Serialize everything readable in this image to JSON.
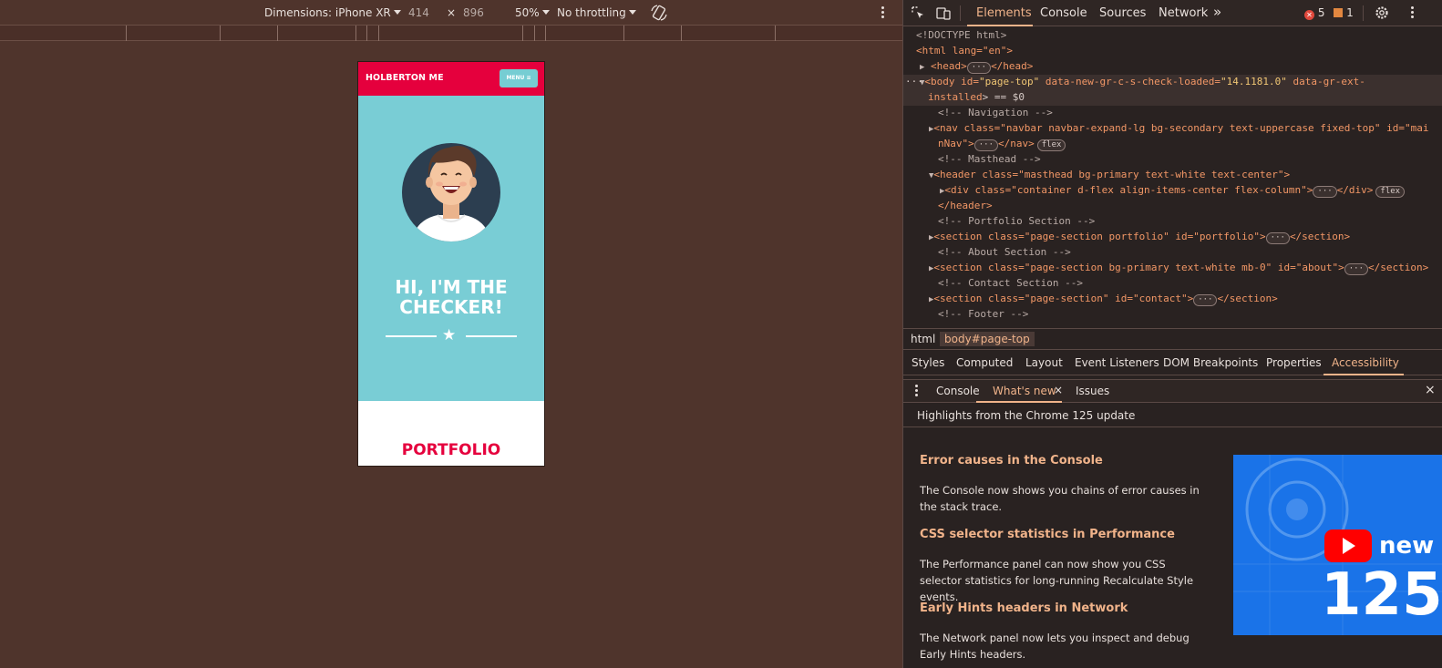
{
  "device_toolbar": {
    "dimensions_label": "Dimensions: iPhone XR",
    "width": "414",
    "times": "×",
    "height": "896",
    "zoom": "50%",
    "throttling": "No throttling"
  },
  "site": {
    "brand": "HOLBERTON ME",
    "menu_label": "MENU ≡",
    "headline": "HI, I'M THE CHECKER!",
    "divider_star": "★",
    "section_title": "PORTFOLIO"
  },
  "devtools": {
    "tabs": [
      "Elements",
      "Console",
      "Sources",
      "Network"
    ],
    "more_tabs": "»",
    "errors": "5",
    "warnings": "1",
    "dom": {
      "doctype": "<!DOCTYPE html>",
      "html_open": "<html lang=\"en\">",
      "head": "<head>",
      "head_close": "</head>",
      "body_tag": "<body",
      "body_id_attr": " id=",
      "body_id_val": "\"page-top\"",
      "body_attr2": " data-new-gr-c-s-check-loaded=",
      "body_val2": "\"14.1181.0\"",
      "body_attr3": " data-gr-ext-",
      "body_attr3b": "installed",
      "body_eq": "> == $0",
      "c_nav": "<!-- Navigation -->",
      "nav_line": "<nav class=\"navbar navbar-expand-lg bg-secondary text-uppercase fixed-top\" id=\"mai",
      "nav_line2": "nNav\">",
      "nav_close": "</nav>",
      "c_masthead": "<!-- Masthead -->",
      "header_line": "<header class=\"masthead bg-primary text-white text-center\">",
      "div_line": "<div class=\"container d-flex align-items-center flex-column\">",
      "div_close": "</div>",
      "header_close": "</header>",
      "c_portfolio": "<!-- Portfolio Section -->",
      "section1": "<section class=\"page-section portfolio\" id=\"portfolio\">",
      "section_close": "</section>",
      "c_about": "<!-- About Section -->",
      "section2": "<section class=\"page-section bg-primary text-white mb-0\" id=\"about\">",
      "c_contact": "<!-- Contact Section -->",
      "section3": "<section class=\"page-section\" id=\"contact\">",
      "c_footer": "<!-- Footer -->",
      "pill_flex": "flex",
      "ellipsis": "···",
      "row_dots": "···"
    },
    "breadcrumbs": [
      "html",
      "body#page-top"
    ],
    "subtabs": [
      "Styles",
      "Computed",
      "Layout",
      "Event Listeners",
      "DOM Breakpoints",
      "Properties",
      "Accessibility"
    ],
    "drawer_tabs": [
      "Console",
      "What's new",
      "Issues"
    ],
    "drawer_close": "×",
    "drawer_tab_close": "×",
    "whats_new_header": "Highlights from the Chrome 125 update",
    "whats_new": [
      {
        "title": "Error causes in the Console",
        "text": "The Console now shows you chains of error causes in the stack trace."
      },
      {
        "title": "CSS selector statistics in Performance",
        "text": "The Performance panel can now show you CSS selector statistics for long-running Recalculate Style events."
      },
      {
        "title": "Early Hints headers in Network",
        "text": "The Network panel now lets you inspect and debug Early Hints headers."
      }
    ],
    "promo_text": "new",
    "promo_number": "125"
  },
  "colors": {
    "site_red": "#e5003d",
    "site_teal": "#79cdd5",
    "devtools_accent": "#f0b38a"
  }
}
